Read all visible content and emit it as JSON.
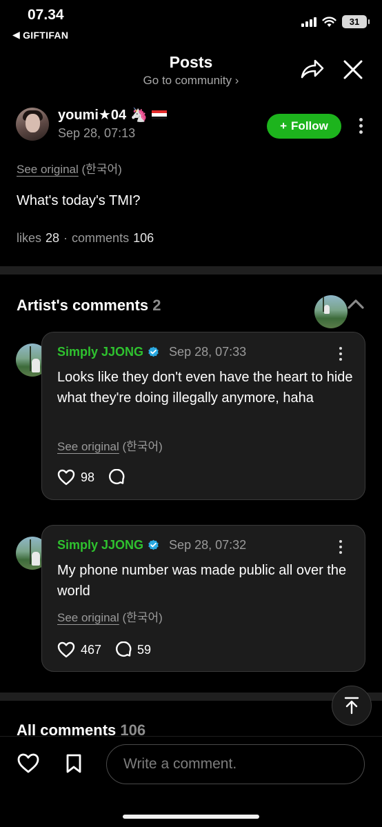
{
  "status": {
    "time": "07.34",
    "back_app": "GIFTIFAN",
    "battery": "31"
  },
  "header": {
    "title": "Posts",
    "subtitle": "Go to community"
  },
  "post": {
    "author": "youmi★04",
    "emoji": "🦄",
    "date": "Sep 28, 07:13",
    "follow_label": "Follow",
    "see_original": "See original",
    "original_lang": "(한국어)",
    "body": "What's today's TMI?",
    "likes_label": "likes",
    "likes": "28",
    "comments_label": "comments",
    "comments": "106"
  },
  "artist_comments": {
    "title": "Artist's comments",
    "count": "2",
    "items": [
      {
        "name": "Simply JJONG",
        "date": "Sep 28, 07:33",
        "text": "Looks like they don't even have the heart to hide what they're doing illegally anymore, haha",
        "see_original": "See original",
        "original_lang": "(한국어)",
        "likes": "98",
        "replies": ""
      },
      {
        "name": "Simply JJONG",
        "date": "Sep 28, 07:32",
        "text": "My phone number was made public all over the world",
        "see_original": "See original",
        "original_lang": "(한국어)",
        "likes": "467",
        "replies": "59"
      }
    ]
  },
  "all_comments": {
    "title": "All comments",
    "count": "106"
  },
  "composer": {
    "placeholder": "Write a comment."
  },
  "colors": {
    "accent_green": "#1db41d",
    "name_green": "#2fc22f",
    "verified_blue": "#2aa8e0"
  }
}
